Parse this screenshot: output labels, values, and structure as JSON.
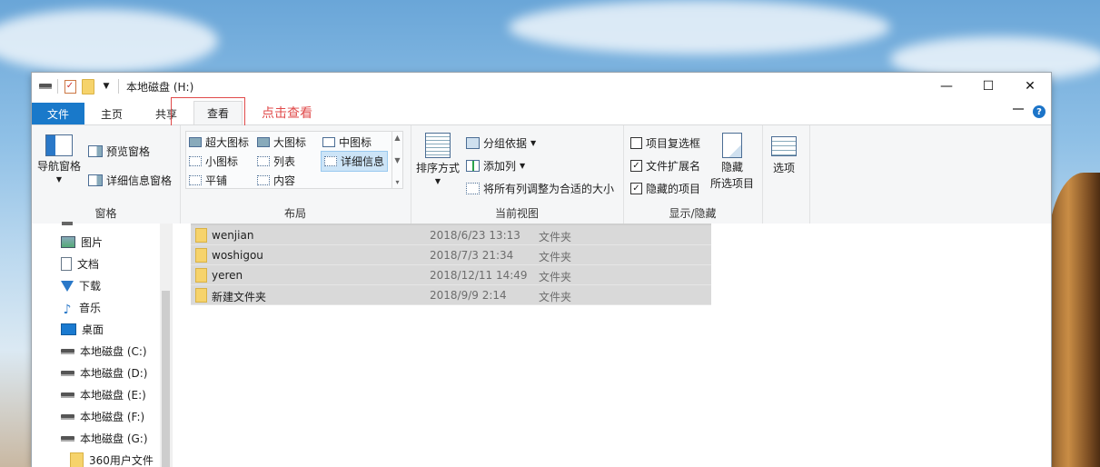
{
  "window": {
    "title": "本地磁盘 (H:)"
  },
  "window_controls": {
    "minimize": "—",
    "maximize": "☐",
    "close": "✕"
  },
  "tabs": {
    "file": "文件",
    "home": "主页",
    "share": "共享",
    "view": "查看",
    "annotation": "点击查看"
  },
  "ribbon": {
    "panes": {
      "nav_pane": "导航窗格",
      "preview_pane": "预览窗格",
      "details_pane": "详细信息窗格",
      "label": "窗格"
    },
    "layout": {
      "extra_large": "超大图标",
      "large": "大图标",
      "medium": "中图标",
      "small": "小图标",
      "list": "列表",
      "details": "详细信息",
      "tiles": "平铺",
      "content": "内容",
      "label": "布局"
    },
    "current_view": {
      "sort_by": "排序方式",
      "group_by": "分组依据",
      "add_column": "添加列",
      "fit_columns": "将所有列调整为合适的大小",
      "label": "当前视图"
    },
    "show_hide": {
      "item_checkboxes": "项目复选框",
      "file_extensions": "文件扩展名",
      "hidden_items": "隐藏的项目",
      "hide_selected_1": "隐藏",
      "hide_selected_2": "所选项目",
      "label": "显示/隐藏",
      "checked": {
        "item_checkboxes": false,
        "file_extensions": true,
        "hidden_items": true
      }
    },
    "options": {
      "label": "选项"
    }
  },
  "nav": {
    "items": [
      {
        "label": "图片",
        "icon": "pictures-icon"
      },
      {
        "label": "文档",
        "icon": "documents-icon"
      },
      {
        "label": "下载",
        "icon": "downloads-icon"
      },
      {
        "label": "音乐",
        "icon": "music-icon"
      },
      {
        "label": "桌面",
        "icon": "desktop-icon"
      },
      {
        "label": "本地磁盘 (C:)",
        "icon": "drive-icon"
      },
      {
        "label": "本地磁盘 (D:)",
        "icon": "drive-icon"
      },
      {
        "label": "本地磁盘 (E:)",
        "icon": "drive-icon"
      },
      {
        "label": "本地磁盘 (F:)",
        "icon": "drive-icon"
      },
      {
        "label": "本地磁盘 (G:)",
        "icon": "drive-icon"
      },
      {
        "label": "360用户文件",
        "icon": "folder-icon"
      }
    ]
  },
  "files": [
    {
      "name": "wenjian",
      "date": "2018/6/23 13:13",
      "type": "文件夹"
    },
    {
      "name": "woshigou",
      "date": "2018/7/3 21:34",
      "type": "文件夹"
    },
    {
      "name": "yeren",
      "date": "2018/12/11 14:49",
      "type": "文件夹"
    },
    {
      "name": "新建文件夹",
      "date": "2018/9/9 2:14",
      "type": "文件夹"
    }
  ],
  "colors": {
    "accent": "#1979ca",
    "annotation": "#e04a4a",
    "selection": "#d9d9d9"
  }
}
